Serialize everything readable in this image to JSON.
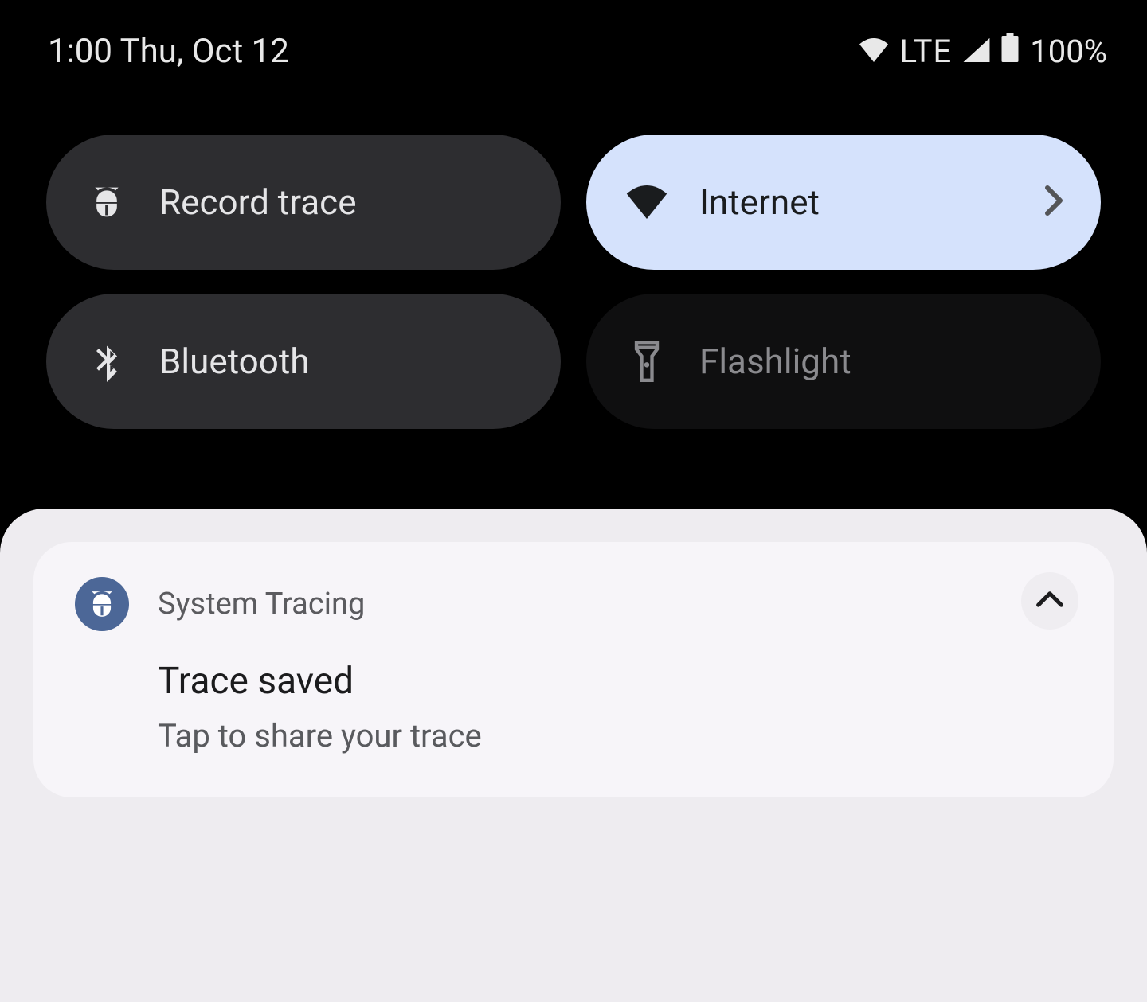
{
  "status_bar": {
    "time_date": "1:00 Thu, Oct 12",
    "network_label": "LTE",
    "battery_label": "100%"
  },
  "tiles": [
    {
      "label": "Record trace",
      "icon": "bug-icon",
      "state": "inactive",
      "has_chevron": false
    },
    {
      "label": "Internet",
      "icon": "wifi-icon",
      "state": "active",
      "has_chevron": true
    },
    {
      "label": "Bluetooth",
      "icon": "bluetooth-icon",
      "state": "inactive",
      "has_chevron": false
    },
    {
      "label": "Flashlight",
      "icon": "flashlight-icon",
      "state": "dimmed",
      "has_chevron": false
    }
  ],
  "notification": {
    "app_name": "System Tracing",
    "title": "Trace saved",
    "subtitle": "Tap to share your trace"
  }
}
